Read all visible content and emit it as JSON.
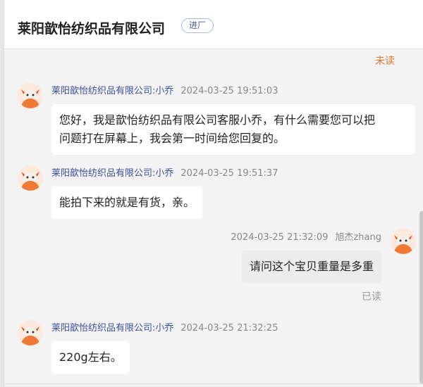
{
  "header": {
    "shop_name": "莱阳歆怡纺织品有限公司",
    "tag": "进厂"
  },
  "status_unread": "未读",
  "messages": [
    {
      "sender": "莱阳歆怡纺织品有限公司:小乔",
      "time": "2024-03-25 19:51:03",
      "lines": [
        "您好，我是歆怡纺织品有限公司客服小乔，有什么需要您可以把",
        "问题打在屏幕上，我会第一时间给您回复的。"
      ]
    },
    {
      "sender": "莱阳歆怡纺织品有限公司:小乔",
      "time": "2024-03-25 19:51:37",
      "lines": [
        "能拍下来的就是有货，亲。"
      ]
    },
    {
      "sender": "旭杰zhang",
      "time": "2024-03-25 21:32:09",
      "lines": [
        "请问这个宝贝重量是多重"
      ],
      "status": "已读"
    },
    {
      "sender": "莱阳歆怡纺织品有限公司:小乔",
      "time": "2024-03-25 21:32:25",
      "lines": [
        "220g左右。"
      ]
    }
  ],
  "colors": {
    "sender_link": "#3e4fa0",
    "unread": "#e0772b",
    "avatar_orange": "#f07a35"
  },
  "icons": {
    "avatar": "orange-bull-avatar-icon"
  }
}
